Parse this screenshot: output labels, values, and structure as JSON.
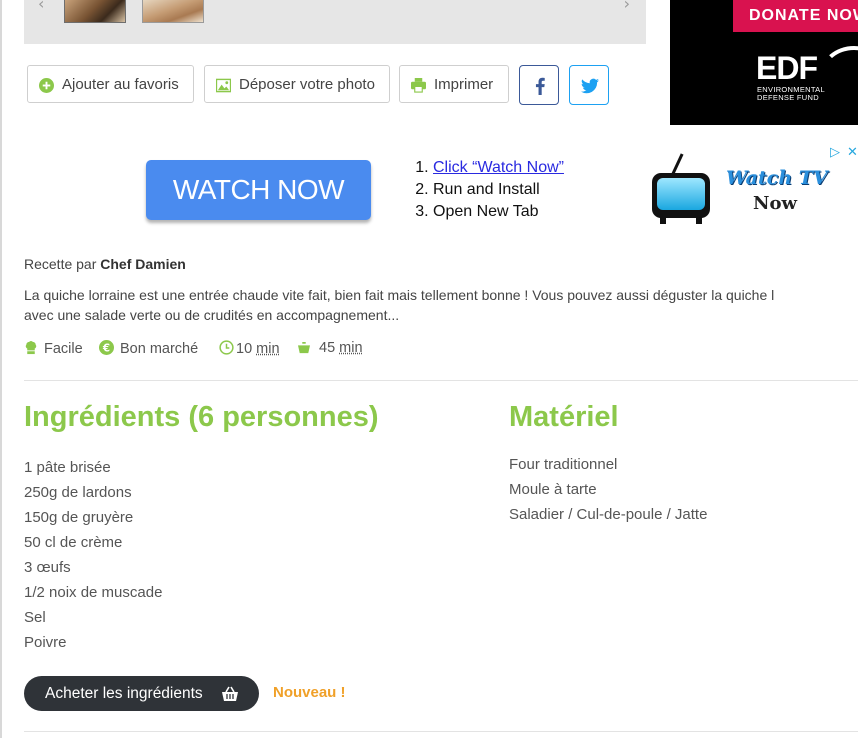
{
  "ads": {
    "edf": {
      "donate_label": "DONATE NOW",
      "logo_text": "EDF",
      "sub_line1": "ENVIRONMENTAL",
      "sub_line2": "DEFENSE FUND"
    },
    "watch": {
      "button_label": "WATCH NOW",
      "steps": [
        "Click “Watch Now”",
        "Run and Install",
        "Open New Tab"
      ],
      "brand_line1": "Watch TV",
      "brand_line2": "Now",
      "close_glyph": "✕",
      "choices_glyph": "▷"
    }
  },
  "gallery": {
    "prev_glyph": "‹",
    "next_glyph": "›"
  },
  "actions": {
    "favorites": "Ajouter au favoris",
    "photo": "Déposer votre photo",
    "print": "Imprimer"
  },
  "recipe": {
    "author_prefix": "Recette par",
    "author_name": "Chef Damien",
    "description_line1": "La quiche lorraine est une entrée chaude vite fait, bien fait mais tellement bonne ! Vous pouvez aussi déguster la quiche l",
    "description_line2": "avec une salade verte ou de crudités en accompagnement...",
    "difficulty": "Facile",
    "cost": "Bon marché",
    "prep_time": "10",
    "cook_time": "45",
    "time_unit": "min"
  },
  "ingredients": {
    "title": "Ingrédients (6 personnes)",
    "items": [
      "1 pâte brisée",
      "250g de lardons",
      "150g de gruyère",
      "50 cl de crème",
      "3 œufs",
      "1/2 noix de muscade",
      "Sel",
      "Poivre"
    ],
    "buy_label": "Acheter les ingrédients",
    "new_label": "Nouveau !"
  },
  "materiel": {
    "title": "Matériel",
    "items": [
      "Four traditionnel",
      "Moule à tarte",
      "Saladier / Cul-de-poule / Jatte"
    ]
  },
  "colors": {
    "accent_green": "#8cc84b",
    "new_orange": "#f0a028",
    "dark_button": "#2f3338",
    "ad_blue": "#4a8bef"
  }
}
